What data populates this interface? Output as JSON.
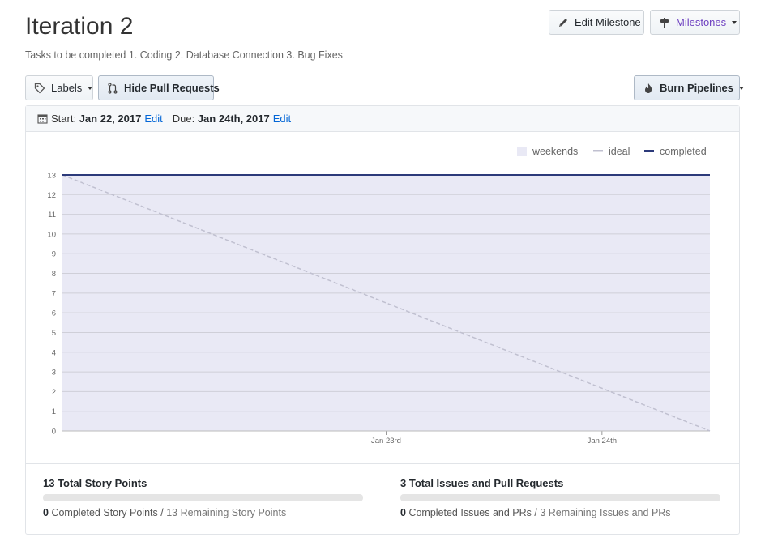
{
  "milestone": {
    "title": "Iteration 2",
    "description": "Tasks to be completed 1. Coding 2. Database Connection 3. Bug Fixes"
  },
  "toolbar": {
    "edit_milestone_label": "Edit Milestone",
    "milestones_label": "Milestones",
    "labels_label": "Labels",
    "hide_prs_label": "Hide Pull Requests",
    "burn_pipelines_label": "Burn Pipelines"
  },
  "dates": {
    "start_label": "Start:",
    "start_value": "Jan 22, 2017",
    "start_edit": "Edit",
    "due_label": "Due:",
    "due_value": "Jan 24th, 2017",
    "due_edit": "Edit"
  },
  "chart_data": {
    "type": "line",
    "legend": [
      "weekends",
      "ideal",
      "completed"
    ],
    "legend_position": "top-right",
    "x_ticks": [
      "Jan 23rd",
      "Jan 24th"
    ],
    "ylim": [
      0,
      13
    ],
    "yticks": [
      0,
      1,
      2,
      3,
      4,
      5,
      6,
      7,
      8,
      9,
      10,
      11,
      12,
      13
    ],
    "xlim": [
      "2017-01-22",
      "2017-01-25"
    ],
    "grid": true,
    "series": [
      {
        "name": "ideal",
        "x": [
          "2017-01-22",
          "2017-01-25"
        ],
        "values": [
          13,
          0
        ]
      },
      {
        "name": "completed",
        "x": [
          "2017-01-22",
          "2017-01-25"
        ],
        "values": [
          13,
          13
        ]
      }
    ],
    "shaded_region": {
      "name": "weekends",
      "x": [
        "2017-01-22",
        "2017-01-25"
      ]
    },
    "colors": {
      "weekends": "#e9e9f5",
      "ideal": "#c0c0d0",
      "completed": "#2c3a7a"
    }
  },
  "stats": {
    "story_points_title": "13 Total Story Points",
    "story_points_completed": "0",
    "story_points_completed_label": "Completed Story Points",
    "story_points_remaining": "13 Remaining Story Points",
    "story_points_progress": 0,
    "issues_title": "3 Total Issues and Pull Requests",
    "issues_completed": "0",
    "issues_completed_label": "Completed Issues and PRs",
    "issues_remaining": "3 Remaining Issues and PRs",
    "issues_progress": 0,
    "separator": "/"
  },
  "icons": {
    "edit": "pencil-icon",
    "milestones": "milestone-icon",
    "labels": "tag-icon",
    "hide_prs": "git-pull-request-icon",
    "burn": "flame-icon",
    "calendar": "calendar-icon"
  }
}
